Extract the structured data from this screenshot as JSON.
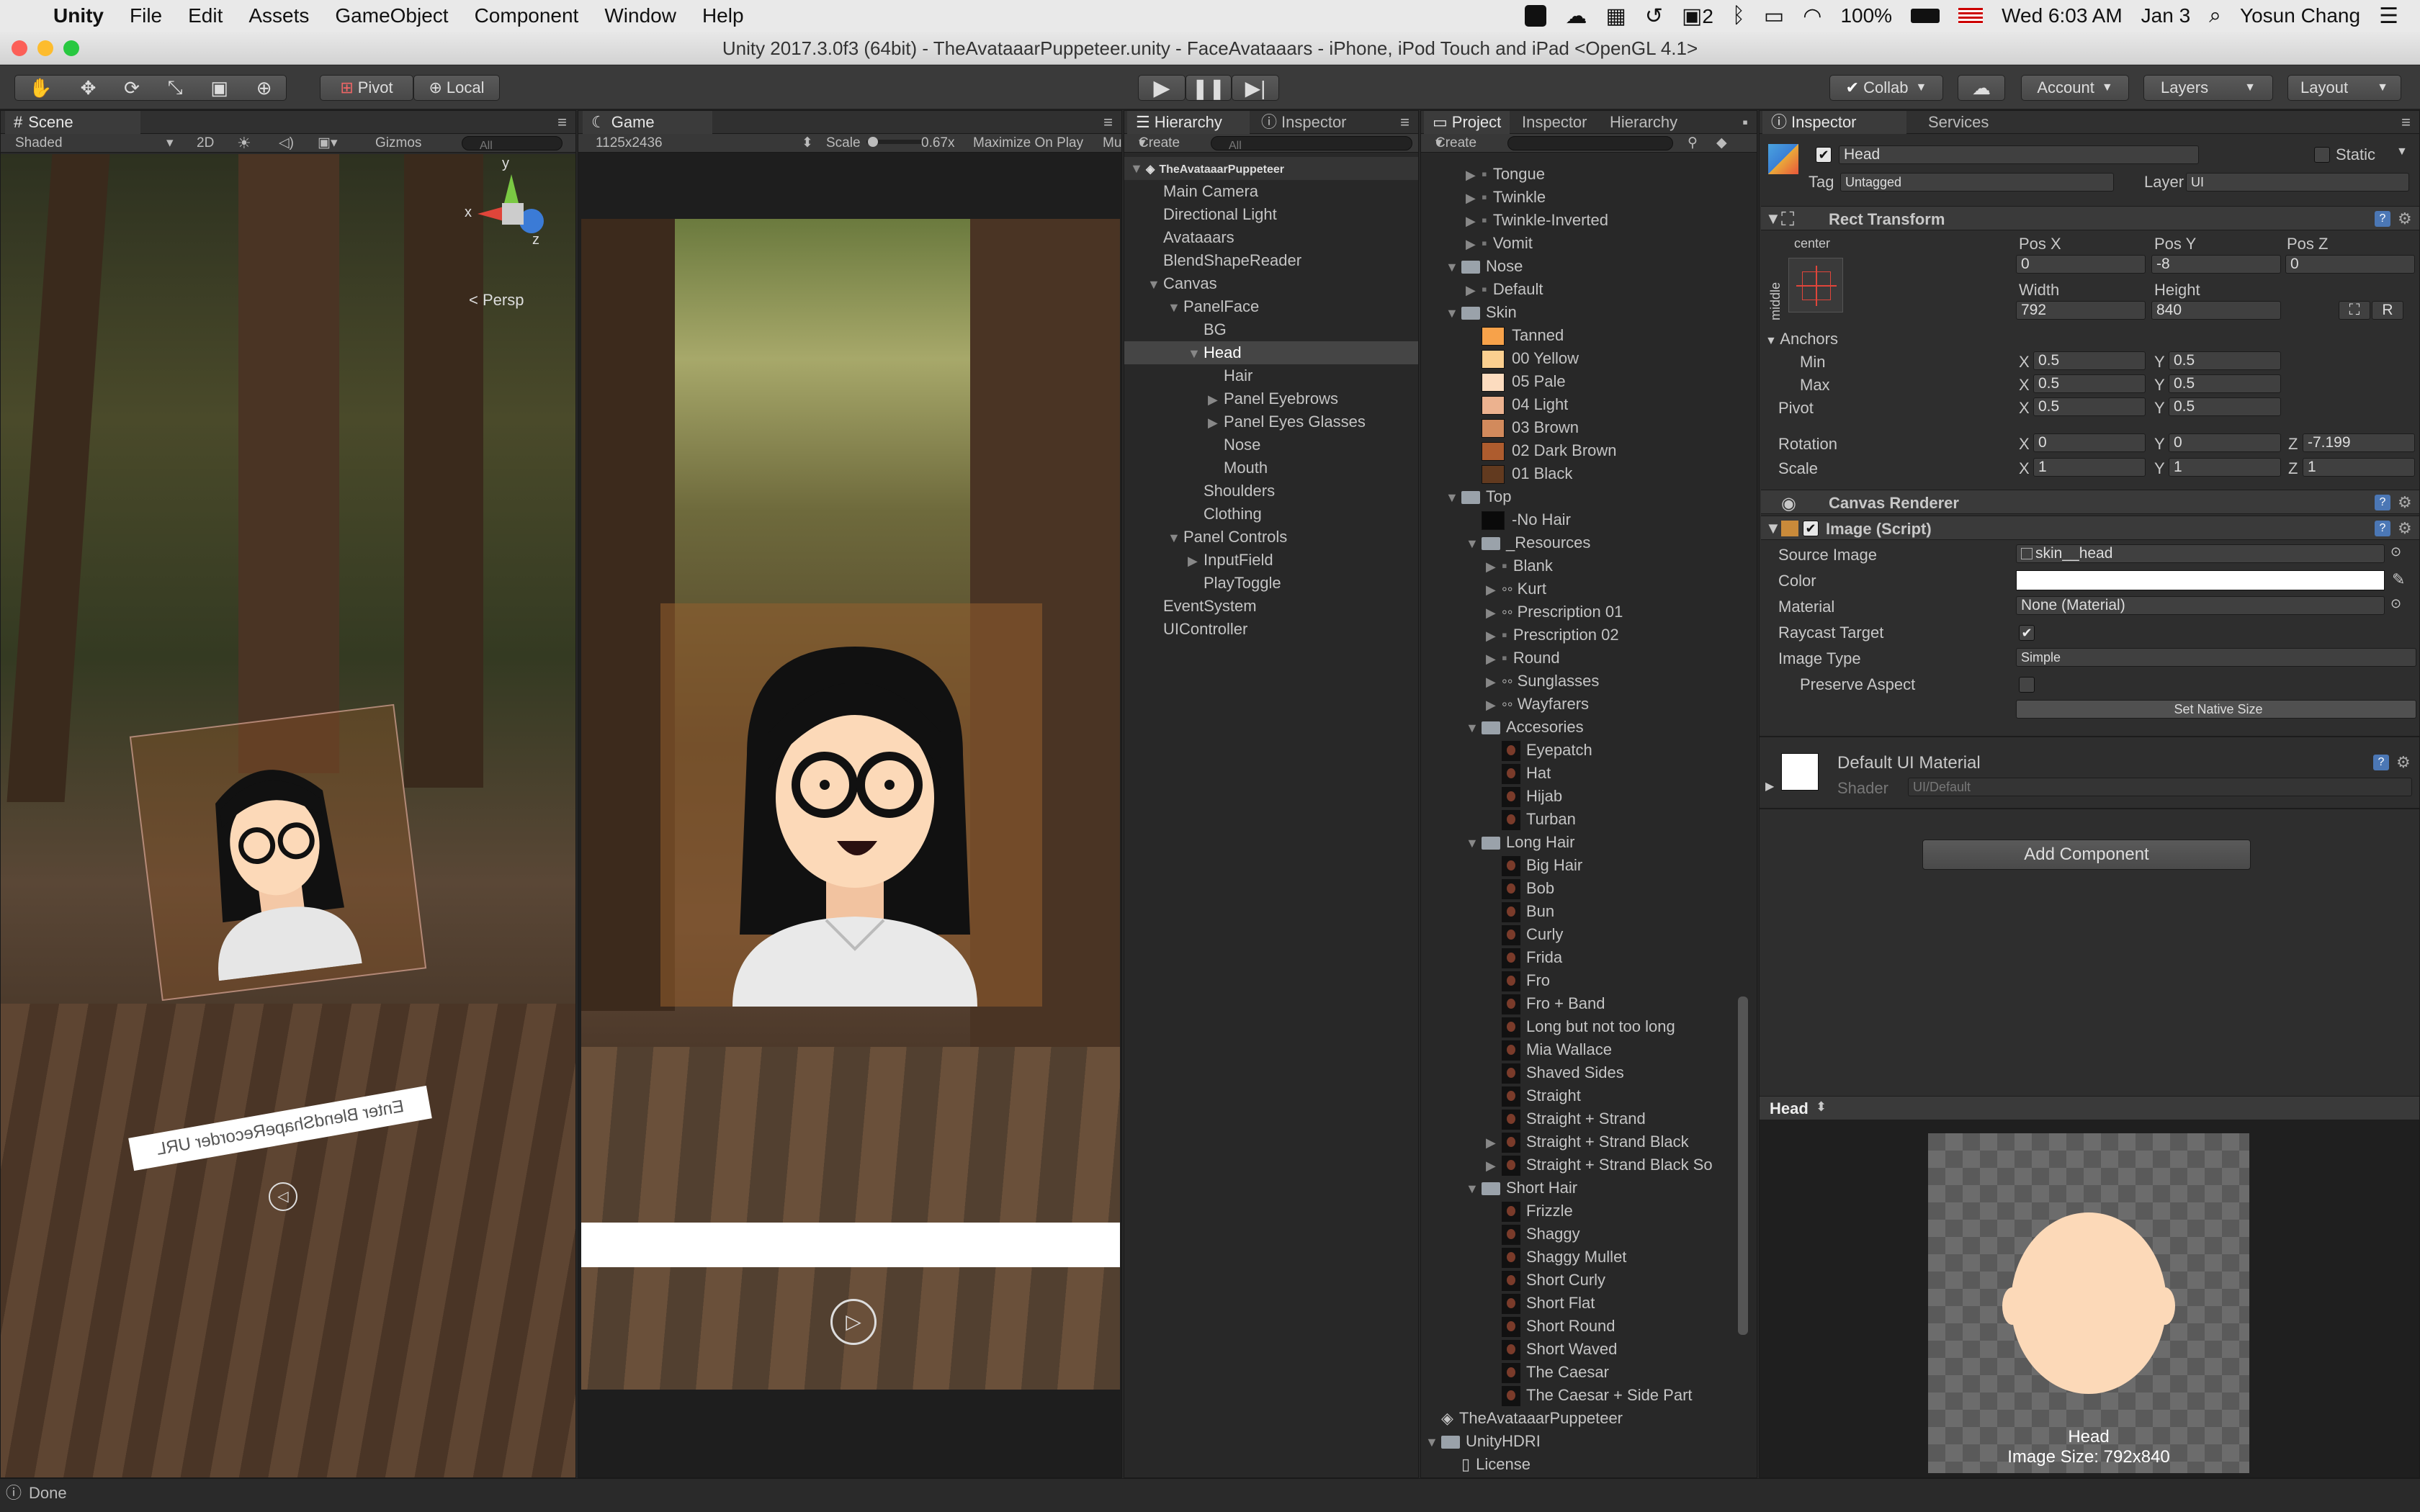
{
  "menubar": {
    "app": "Unity",
    "items": [
      "File",
      "Edit",
      "Assets",
      "GameObject",
      "Component",
      "Window",
      "Help"
    ],
    "status": {
      "battery": "100%",
      "datetime": "Wed 6:03 AM",
      "date": "Jan 3",
      "user": "Yosun Chang",
      "badge": "2"
    }
  },
  "window": {
    "title": "Unity 2017.3.0f3 (64bit) - TheAvataaarPuppeteer.unity - FaceAvataaars - iPhone, iPod Touch and iPad <OpenGL 4.1>"
  },
  "toolbar": {
    "pivot": "Pivot",
    "local": "Local",
    "collab": "Collab",
    "account": "Account",
    "layers": "Layers",
    "layout": "Layout"
  },
  "scene": {
    "tab": "Scene",
    "shading": "Shaded",
    "mode2d": "2D",
    "gizmos": "Gizmos",
    "search": "All",
    "persp": "Persp",
    "url_text": "Enter BlendShapeRecorder URL"
  },
  "game": {
    "tab": "Game",
    "resolution": "1125x2436",
    "scale_label": "Scale",
    "scale_value": "0.67x",
    "maximize": "Maximize On Play",
    "mute": "Mu"
  },
  "hierarchy": {
    "tabs": [
      "Hierarchy",
      "Inspector"
    ],
    "create": "Create",
    "search": "All",
    "scene": "TheAvataaarPuppeteer",
    "rows": [
      {
        "label": "Main Camera",
        "indent": 0,
        "arrow": ""
      },
      {
        "label": "Directional Light",
        "indent": 0,
        "arrow": ""
      },
      {
        "label": "Avataaars",
        "indent": 0,
        "arrow": ""
      },
      {
        "label": "BlendShapeReader",
        "indent": 0,
        "arrow": ""
      },
      {
        "label": "Canvas",
        "indent": 0,
        "arrow": "▼"
      },
      {
        "label": "PanelFace",
        "indent": 1,
        "arrow": "▼"
      },
      {
        "label": "BG",
        "indent": 2,
        "arrow": ""
      },
      {
        "label": "Head",
        "indent": 2,
        "arrow": "▼",
        "selected": true
      },
      {
        "label": "Hair",
        "indent": 3,
        "arrow": ""
      },
      {
        "label": "Panel Eyebrows",
        "indent": 3,
        "arrow": "▶"
      },
      {
        "label": "Panel Eyes Glasses",
        "indent": 3,
        "arrow": "▶"
      },
      {
        "label": "Nose",
        "indent": 3,
        "arrow": ""
      },
      {
        "label": "Mouth",
        "indent": 3,
        "arrow": ""
      },
      {
        "label": "Shoulders",
        "indent": 2,
        "arrow": ""
      },
      {
        "label": "Clothing",
        "indent": 2,
        "arrow": ""
      },
      {
        "label": "Panel Controls",
        "indent": 1,
        "arrow": "▼"
      },
      {
        "label": "InputField",
        "indent": 2,
        "arrow": "▶"
      },
      {
        "label": "PlayToggle",
        "indent": 2,
        "arrow": ""
      },
      {
        "label": "EventSystem",
        "indent": 0,
        "arrow": ""
      },
      {
        "label": "UIController",
        "indent": 0,
        "arrow": ""
      }
    ]
  },
  "project": {
    "tabs": [
      "Project",
      "Inspector",
      "Hierarchy"
    ],
    "create": "Create",
    "rows": [
      {
        "label": "Tongue",
        "indent": 2,
        "arrow": "▶",
        "icon": "small"
      },
      {
        "label": "Twinkle",
        "indent": 2,
        "arrow": "▶",
        "icon": "small"
      },
      {
        "label": "Twinkle-Inverted",
        "indent": 2,
        "arrow": "▶",
        "icon": "small"
      },
      {
        "label": "Vomit",
        "indent": 2,
        "arrow": "▶",
        "icon": "small"
      },
      {
        "label": "Nose",
        "indent": 1,
        "arrow": "▼",
        "icon": "folder"
      },
      {
        "label": "Default",
        "indent": 2,
        "arrow": "▶",
        "icon": "small"
      },
      {
        "label": "Skin",
        "indent": 1,
        "arrow": "▼",
        "icon": "folder"
      },
      {
        "label": "Tanned",
        "indent": 2,
        "arrow": "",
        "icon": "swatch",
        "color": "#f7a24a"
      },
      {
        "label": "00 Yellow",
        "indent": 2,
        "arrow": "",
        "icon": "swatch",
        "color": "#fbcf8f"
      },
      {
        "label": "05 Pale",
        "indent": 2,
        "arrow": "",
        "icon": "swatch",
        "color": "#fcdcbf"
      },
      {
        "label": "04 Light",
        "indent": 2,
        "arrow": "",
        "icon": "swatch",
        "color": "#ecb28f"
      },
      {
        "label": "03 Brown",
        "indent": 2,
        "arrow": "",
        "icon": "swatch",
        "color": "#d28a5c"
      },
      {
        "label": "02 Dark Brown",
        "indent": 2,
        "arrow": "",
        "icon": "swatch",
        "color": "#ae5c2e"
      },
      {
        "label": "01 Black",
        "indent": 2,
        "arrow": "",
        "icon": "swatch",
        "color": "#623a1f"
      },
      {
        "label": "Top",
        "indent": 1,
        "arrow": "▼",
        "icon": "folder"
      },
      {
        "label": "-No Hair",
        "indent": 2,
        "arrow": "",
        "icon": "swatch",
        "color": "#0a0a0a"
      },
      {
        "label": "_Resources",
        "indent": 2,
        "arrow": "▼",
        "icon": "folder"
      },
      {
        "label": "Blank",
        "indent": 3,
        "arrow": "▶",
        "icon": "small"
      },
      {
        "label": "Kurt",
        "indent": 3,
        "arrow": "▶",
        "icon": "glasses"
      },
      {
        "label": "Prescription 01",
        "indent": 3,
        "arrow": "▶",
        "icon": "glasses"
      },
      {
        "label": "Prescription 02",
        "indent": 3,
        "arrow": "▶",
        "icon": "small"
      },
      {
        "label": "Round",
        "indent": 3,
        "arrow": "▶",
        "icon": "small"
      },
      {
        "label": "Sunglasses",
        "indent": 3,
        "arrow": "▶",
        "icon": "glasses"
      },
      {
        "label": "Wayfarers",
        "indent": 3,
        "arrow": "▶",
        "icon": "glasses"
      },
      {
        "label": "Accesories",
        "indent": 2,
        "arrow": "▼",
        "icon": "folder"
      },
      {
        "label": "Eyepatch",
        "indent": 3,
        "arrow": "",
        "icon": "prefab"
      },
      {
        "label": "Hat",
        "indent": 3,
        "arrow": "",
        "icon": "prefab"
      },
      {
        "label": "Hijab",
        "indent": 3,
        "arrow": "",
        "icon": "prefab"
      },
      {
        "label": "Turban",
        "indent": 3,
        "arrow": "",
        "icon": "prefab"
      },
      {
        "label": "Long Hair",
        "indent": 2,
        "arrow": "▼",
        "icon": "folder"
      },
      {
        "label": "Big Hair",
        "indent": 3,
        "arrow": "",
        "icon": "prefab"
      },
      {
        "label": "Bob",
        "indent": 3,
        "arrow": "",
        "icon": "prefab"
      },
      {
        "label": "Bun",
        "indent": 3,
        "arrow": "",
        "icon": "prefab"
      },
      {
        "label": "Curly",
        "indent": 3,
        "arrow": "",
        "icon": "prefab"
      },
      {
        "label": "Frida",
        "indent": 3,
        "arrow": "",
        "icon": "prefab"
      },
      {
        "label": "Fro",
        "indent": 3,
        "arrow": "",
        "icon": "prefab"
      },
      {
        "label": "Fro + Band",
        "indent": 3,
        "arrow": "",
        "icon": "prefab"
      },
      {
        "label": "Long but not too long",
        "indent": 3,
        "arrow": "",
        "icon": "prefab"
      },
      {
        "label": "Mia Wallace",
        "indent": 3,
        "arrow": "",
        "icon": "prefab"
      },
      {
        "label": "Shaved Sides",
        "indent": 3,
        "arrow": "",
        "icon": "prefab"
      },
      {
        "label": "Straight",
        "indent": 3,
        "arrow": "",
        "icon": "prefab"
      },
      {
        "label": "Straight + Strand",
        "indent": 3,
        "arrow": "",
        "icon": "prefab"
      },
      {
        "label": "Straight + Strand Black",
        "indent": 3,
        "arrow": "▶",
        "icon": "prefab"
      },
      {
        "label": "Straight + Strand Black So",
        "indent": 3,
        "arrow": "▶",
        "icon": "prefab"
      },
      {
        "label": "Short Hair",
        "indent": 2,
        "arrow": "▼",
        "icon": "folder"
      },
      {
        "label": "Frizzle",
        "indent": 3,
        "arrow": "",
        "icon": "prefab"
      },
      {
        "label": "Shaggy",
        "indent": 3,
        "arrow": "",
        "icon": "prefab"
      },
      {
        "label": "Shaggy Mullet",
        "indent": 3,
        "arrow": "",
        "icon": "prefab"
      },
      {
        "label": "Short Curly",
        "indent": 3,
        "arrow": "",
        "icon": "prefab"
      },
      {
        "label": "Short Flat",
        "indent": 3,
        "arrow": "",
        "icon": "prefab"
      },
      {
        "label": "Short Round",
        "indent": 3,
        "arrow": "",
        "icon": "prefab"
      },
      {
        "label": "Short Waved",
        "indent": 3,
        "arrow": "",
        "icon": "prefab"
      },
      {
        "label": "The Caesar",
        "indent": 3,
        "arrow": "",
        "icon": "prefab"
      },
      {
        "label": "The Caesar + Side Part",
        "indent": 3,
        "arrow": "",
        "icon": "prefab"
      },
      {
        "label": "TheAvataaarPuppeteer",
        "indent": 0,
        "arrow": "",
        "icon": "unity"
      },
      {
        "label": "UnityHDRI",
        "indent": 0,
        "arrow": "▼",
        "icon": "folder"
      },
      {
        "label": "License",
        "indent": 1,
        "arrow": "",
        "icon": "file"
      }
    ]
  },
  "inspector": {
    "tabs": [
      "Inspector",
      "Services"
    ],
    "object_name": "Head",
    "static": "Static",
    "tag_label": "Tag",
    "tag_value": "Untagged",
    "layer_label": "Layer",
    "layer_value": "UI",
    "rect_transform": {
      "title": "Rect Transform",
      "anchor_h": "center",
      "anchor_v": "middle",
      "posx_label": "Pos X",
      "posy_label": "Pos Y",
      "posz_label": "Pos Z",
      "posx": "0",
      "posy": "-8",
      "posz": "0",
      "width_label": "Width",
      "height_label": "Height",
      "width": "792",
      "height": "840",
      "r_button": "R",
      "anchors_label": "Anchors",
      "min_label": "Min",
      "max_label": "Max",
      "min_x": "0.5",
      "min_y": "0.5",
      "max_x": "0.5",
      "max_y": "0.5",
      "pivot_label": "Pivot",
      "pivot_x": "0.5",
      "pivot_y": "0.5",
      "rotation_label": "Rotation",
      "rot_x": "0",
      "rot_y": "0",
      "rot_z": "-7.199",
      "scale_label": "Scale",
      "scale_x": "1",
      "scale_y": "1",
      "scale_z": "1",
      "axis_x": "X",
      "axis_y": "Y",
      "axis_z": "Z"
    },
    "canvas_renderer": {
      "title": "Canvas Renderer"
    },
    "image": {
      "title": "Image (Script)",
      "source_label": "Source Image",
      "source": "skin__head",
      "color_label": "Color",
      "material_label": "Material",
      "material": "None (Material)",
      "raycast_label": "Raycast Target",
      "type_label": "Image Type",
      "type": "Simple",
      "preserve_label": "Preserve Aspect",
      "native_button": "Set Native Size"
    },
    "material": {
      "title": "Default UI Material",
      "shader_label": "Shader",
      "shader": "UI/Default"
    },
    "add_component": "Add Component",
    "preview": {
      "title": "Head",
      "caption": "Head",
      "size": "Image Size: 792x840"
    }
  },
  "statusbar": {
    "text": "Done"
  },
  "colors": {
    "accent_blue": "#4b77b5",
    "skin": "#fcd9b8",
    "selected": "#454545"
  }
}
